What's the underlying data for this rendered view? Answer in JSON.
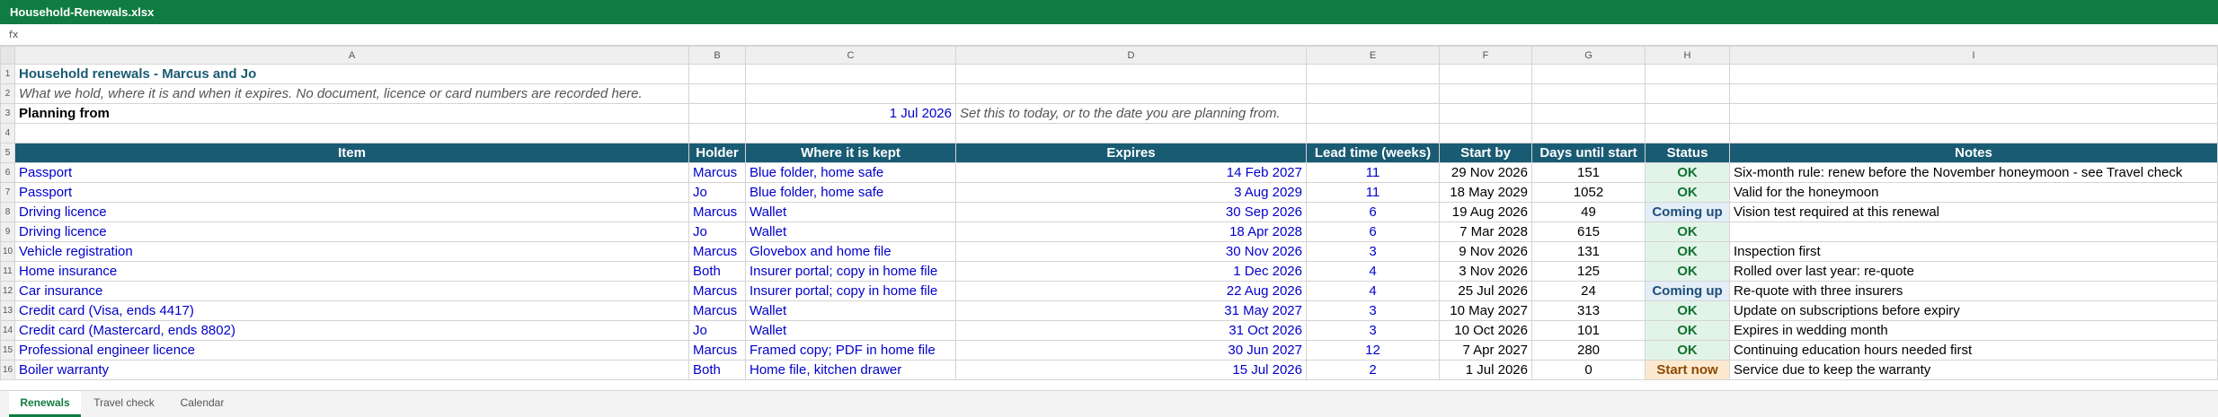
{
  "window": {
    "title": "Household-Renewals.xlsx"
  },
  "formula_bar": {
    "fx_label": "fx",
    "value": ""
  },
  "columns": [
    "A",
    "B",
    "C",
    "D",
    "E",
    "F",
    "G",
    "H",
    "I"
  ],
  "sheet": {
    "title": "Household renewals - Marcus and Jo",
    "subtitle": "What we hold, where it is and when it expires. No document, licence or card numbers are recorded here.",
    "planning_label": "Planning from",
    "planning_date": "1 Jul 2026",
    "planning_note": "Set this to today, or to the date you are planning from."
  },
  "headers": [
    "Item",
    "Holder",
    "Where it is kept",
    "Expires",
    "Lead time (weeks)",
    "Start by",
    "Days until start",
    "Status",
    "Notes"
  ],
  "rows": [
    {
      "item": "Passport",
      "holder": "Marcus",
      "where": "Blue folder, home safe",
      "expires": "14 Feb 2027",
      "lead": "11",
      "start": "29 Nov 2026",
      "days": "151",
      "status": "OK",
      "status_kind": "ok",
      "notes": "Six-month rule: renew before the November honeymoon - see Travel check"
    },
    {
      "item": "Passport",
      "holder": "Jo",
      "where": "Blue folder, home safe",
      "expires": "3 Aug 2029",
      "lead": "11",
      "start": "18 May 2029",
      "days": "1052",
      "status": "OK",
      "status_kind": "ok",
      "notes": "Valid for the honeymoon"
    },
    {
      "item": "Driving licence",
      "holder": "Marcus",
      "where": "Wallet",
      "expires": "30 Sep 2026",
      "lead": "6",
      "start": "19 Aug 2026",
      "days": "49",
      "status": "Coming up",
      "status_kind": "coming",
      "notes": "Vision test required at this renewal"
    },
    {
      "item": "Driving licence",
      "holder": "Jo",
      "where": "Wallet",
      "expires": "18 Apr 2028",
      "lead": "6",
      "start": "7 Mar 2028",
      "days": "615",
      "status": "OK",
      "status_kind": "ok",
      "notes": ""
    },
    {
      "item": "Vehicle registration",
      "holder": "Marcus",
      "where": "Glovebox and home file",
      "expires": "30 Nov 2026",
      "lead": "3",
      "start": "9 Nov 2026",
      "days": "131",
      "status": "OK",
      "status_kind": "ok",
      "notes": "Inspection first"
    },
    {
      "item": "Home insurance",
      "holder": "Both",
      "where": "Insurer portal; copy in home file",
      "expires": "1 Dec 2026",
      "lead": "4",
      "start": "3 Nov 2026",
      "days": "125",
      "status": "OK",
      "status_kind": "ok",
      "notes": "Rolled over last year: re-quote"
    },
    {
      "item": "Car insurance",
      "holder": "Marcus",
      "where": "Insurer portal; copy in home file",
      "expires": "22 Aug 2026",
      "lead": "4",
      "start": "25 Jul 2026",
      "days": "24",
      "status": "Coming up",
      "status_kind": "coming",
      "notes": "Re-quote with three insurers"
    },
    {
      "item": "Credit card (Visa, ends 4417)",
      "holder": "Marcus",
      "where": "Wallet",
      "expires": "31 May 2027",
      "lead": "3",
      "start": "10 May 2027",
      "days": "313",
      "status": "OK",
      "status_kind": "ok",
      "notes": "Update on subscriptions before expiry"
    },
    {
      "item": "Credit card (Mastercard, ends 8802)",
      "holder": "Jo",
      "where": "Wallet",
      "expires": "31 Oct 2026",
      "lead": "3",
      "start": "10 Oct 2026",
      "days": "101",
      "status": "OK",
      "status_kind": "ok",
      "notes": "Expires in wedding month"
    },
    {
      "item": "Professional engineer licence",
      "holder": "Marcus",
      "where": "Framed copy; PDF in home file",
      "expires": "30 Jun 2027",
      "lead": "12",
      "start": "7 Apr 2027",
      "days": "280",
      "status": "OK",
      "status_kind": "ok",
      "notes": "Continuing education hours needed first"
    },
    {
      "item": "Boiler warranty",
      "holder": "Both",
      "where": "Home file, kitchen drawer",
      "expires": "15 Jul 2026",
      "lead": "2",
      "start": "1 Jul 2026",
      "days": "0",
      "status": "Start now",
      "status_kind": "start",
      "notes": "Service due to keep the warranty"
    }
  ],
  "tabs": [
    {
      "label": "Renewals",
      "active": true
    },
    {
      "label": "Travel check",
      "active": false
    },
    {
      "label": "Calendar",
      "active": false
    }
  ]
}
